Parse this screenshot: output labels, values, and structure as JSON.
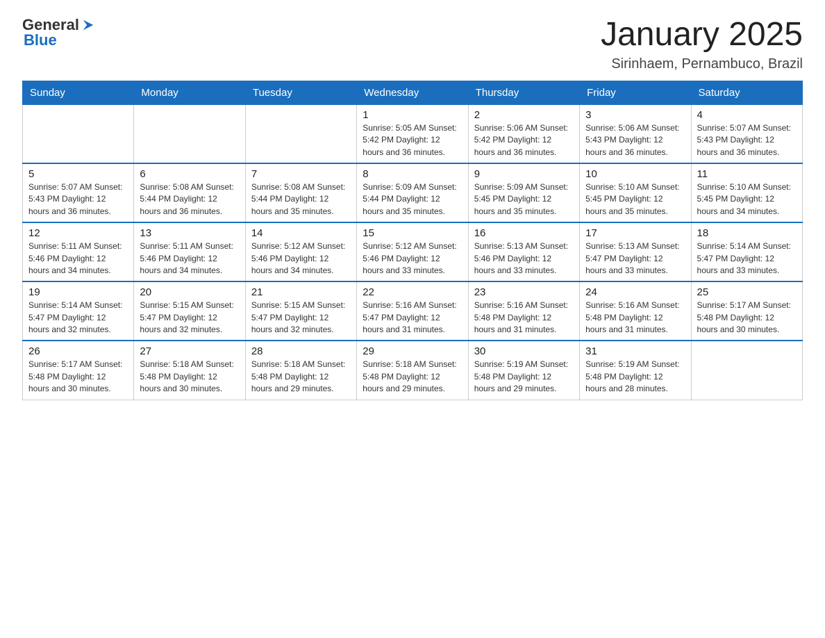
{
  "logo": {
    "text_general": "General",
    "text_blue": "Blue"
  },
  "header": {
    "title": "January 2025",
    "location": "Sirinhaem, Pernambuco, Brazil"
  },
  "days_of_week": [
    "Sunday",
    "Monday",
    "Tuesday",
    "Wednesday",
    "Thursday",
    "Friday",
    "Saturday"
  ],
  "weeks": [
    [
      {
        "day": "",
        "info": ""
      },
      {
        "day": "",
        "info": ""
      },
      {
        "day": "",
        "info": ""
      },
      {
        "day": "1",
        "info": "Sunrise: 5:05 AM\nSunset: 5:42 PM\nDaylight: 12 hours\nand 36 minutes."
      },
      {
        "day": "2",
        "info": "Sunrise: 5:06 AM\nSunset: 5:42 PM\nDaylight: 12 hours\nand 36 minutes."
      },
      {
        "day": "3",
        "info": "Sunrise: 5:06 AM\nSunset: 5:43 PM\nDaylight: 12 hours\nand 36 minutes."
      },
      {
        "day": "4",
        "info": "Sunrise: 5:07 AM\nSunset: 5:43 PM\nDaylight: 12 hours\nand 36 minutes."
      }
    ],
    [
      {
        "day": "5",
        "info": "Sunrise: 5:07 AM\nSunset: 5:43 PM\nDaylight: 12 hours\nand 36 minutes."
      },
      {
        "day": "6",
        "info": "Sunrise: 5:08 AM\nSunset: 5:44 PM\nDaylight: 12 hours\nand 36 minutes."
      },
      {
        "day": "7",
        "info": "Sunrise: 5:08 AM\nSunset: 5:44 PM\nDaylight: 12 hours\nand 35 minutes."
      },
      {
        "day": "8",
        "info": "Sunrise: 5:09 AM\nSunset: 5:44 PM\nDaylight: 12 hours\nand 35 minutes."
      },
      {
        "day": "9",
        "info": "Sunrise: 5:09 AM\nSunset: 5:45 PM\nDaylight: 12 hours\nand 35 minutes."
      },
      {
        "day": "10",
        "info": "Sunrise: 5:10 AM\nSunset: 5:45 PM\nDaylight: 12 hours\nand 35 minutes."
      },
      {
        "day": "11",
        "info": "Sunrise: 5:10 AM\nSunset: 5:45 PM\nDaylight: 12 hours\nand 34 minutes."
      }
    ],
    [
      {
        "day": "12",
        "info": "Sunrise: 5:11 AM\nSunset: 5:46 PM\nDaylight: 12 hours\nand 34 minutes."
      },
      {
        "day": "13",
        "info": "Sunrise: 5:11 AM\nSunset: 5:46 PM\nDaylight: 12 hours\nand 34 minutes."
      },
      {
        "day": "14",
        "info": "Sunrise: 5:12 AM\nSunset: 5:46 PM\nDaylight: 12 hours\nand 34 minutes."
      },
      {
        "day": "15",
        "info": "Sunrise: 5:12 AM\nSunset: 5:46 PM\nDaylight: 12 hours\nand 33 minutes."
      },
      {
        "day": "16",
        "info": "Sunrise: 5:13 AM\nSunset: 5:46 PM\nDaylight: 12 hours\nand 33 minutes."
      },
      {
        "day": "17",
        "info": "Sunrise: 5:13 AM\nSunset: 5:47 PM\nDaylight: 12 hours\nand 33 minutes."
      },
      {
        "day": "18",
        "info": "Sunrise: 5:14 AM\nSunset: 5:47 PM\nDaylight: 12 hours\nand 33 minutes."
      }
    ],
    [
      {
        "day": "19",
        "info": "Sunrise: 5:14 AM\nSunset: 5:47 PM\nDaylight: 12 hours\nand 32 minutes."
      },
      {
        "day": "20",
        "info": "Sunrise: 5:15 AM\nSunset: 5:47 PM\nDaylight: 12 hours\nand 32 minutes."
      },
      {
        "day": "21",
        "info": "Sunrise: 5:15 AM\nSunset: 5:47 PM\nDaylight: 12 hours\nand 32 minutes."
      },
      {
        "day": "22",
        "info": "Sunrise: 5:16 AM\nSunset: 5:47 PM\nDaylight: 12 hours\nand 31 minutes."
      },
      {
        "day": "23",
        "info": "Sunrise: 5:16 AM\nSunset: 5:48 PM\nDaylight: 12 hours\nand 31 minutes."
      },
      {
        "day": "24",
        "info": "Sunrise: 5:16 AM\nSunset: 5:48 PM\nDaylight: 12 hours\nand 31 minutes."
      },
      {
        "day": "25",
        "info": "Sunrise: 5:17 AM\nSunset: 5:48 PM\nDaylight: 12 hours\nand 30 minutes."
      }
    ],
    [
      {
        "day": "26",
        "info": "Sunrise: 5:17 AM\nSunset: 5:48 PM\nDaylight: 12 hours\nand 30 minutes."
      },
      {
        "day": "27",
        "info": "Sunrise: 5:18 AM\nSunset: 5:48 PM\nDaylight: 12 hours\nand 30 minutes."
      },
      {
        "day": "28",
        "info": "Sunrise: 5:18 AM\nSunset: 5:48 PM\nDaylight: 12 hours\nand 29 minutes."
      },
      {
        "day": "29",
        "info": "Sunrise: 5:18 AM\nSunset: 5:48 PM\nDaylight: 12 hours\nand 29 minutes."
      },
      {
        "day": "30",
        "info": "Sunrise: 5:19 AM\nSunset: 5:48 PM\nDaylight: 12 hours\nand 29 minutes."
      },
      {
        "day": "31",
        "info": "Sunrise: 5:19 AM\nSunset: 5:48 PM\nDaylight: 12 hours\nand 28 minutes."
      },
      {
        "day": "",
        "info": ""
      }
    ]
  ]
}
